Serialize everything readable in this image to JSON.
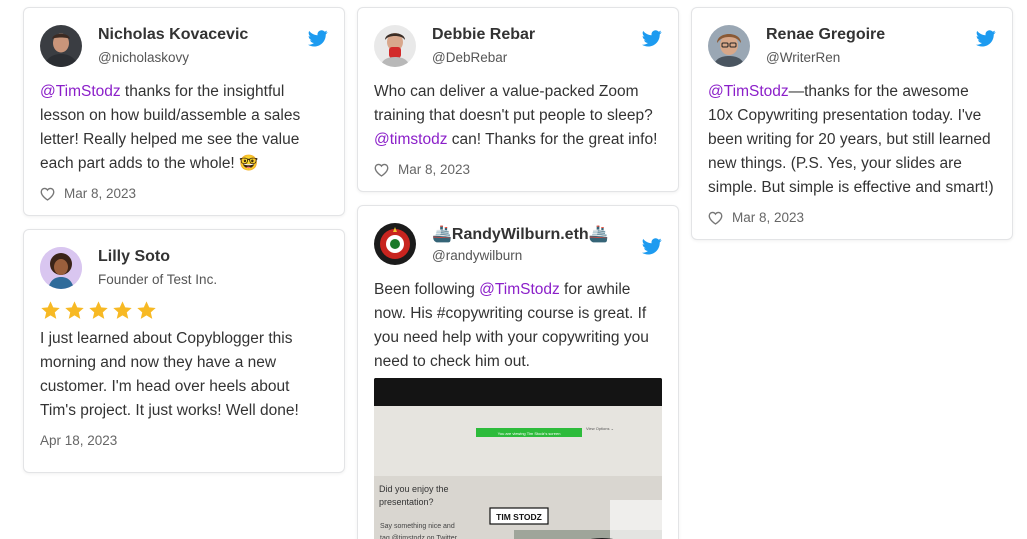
{
  "colors": {
    "mention": "#8b1fc9",
    "twitter": "#1d9bf0",
    "star": "#f7b924"
  },
  "cards": {
    "nicholas": {
      "name": "Nicholas Kovacevic",
      "handle": "@nicholaskovy",
      "mention": "@TimStodz",
      "text": " thanks for the insightful lesson on how build/assemble a sales letter! Really helped me see the value each part adds to the whole! 🤓",
      "date": "Mar 8, 2023"
    },
    "lilly": {
      "name": "Lilly Soto",
      "subtitle": "Founder of Test Inc.",
      "rating": 5,
      "text": "I just learned about Copyblogger this morning and now they have a new customer. I'm head over heels about Tim's project. It just works! Well done!",
      "date": "Apr 18, 2023"
    },
    "debbie": {
      "name": "Debbie Rebar",
      "handle": "@DebRebar",
      "text_before": "Who can deliver a value-packed Zoom training that doesn't put people to sleep? ",
      "mention": "@timstodz",
      "text_after": " can! Thanks for the great info!",
      "date": "Mar 8, 2023"
    },
    "randy": {
      "name": "🚢RandyWilburn.eth🚢",
      "handle": "@randywilburn",
      "text_before": "Been following ",
      "mention": "@TimStodz",
      "text_after": " for awhile now. His #copywriting course is great. If you need help with your copywriting you need to check him out.",
      "photo": {
        "banner": "You are viewing Tim Stodz's screen",
        "view_options": "View Options ⌄",
        "question": "Did you enjoy the presentation?",
        "prompt": "Say something nice and tag @timstodz on Twitter",
        "nameplate": "TIM STODZ"
      }
    },
    "renae": {
      "name": "Renae Gregoire",
      "handle": "@WriterRen",
      "mention": "@TimStodz",
      "text": "—thanks for the awesome 10x Copywriting presentation today. I've been writing for 20 years, but still learned new things. (P.S. Yes, your slides are simple. But simple is effective and smart!)",
      "date": "Mar 8, 2023"
    }
  }
}
